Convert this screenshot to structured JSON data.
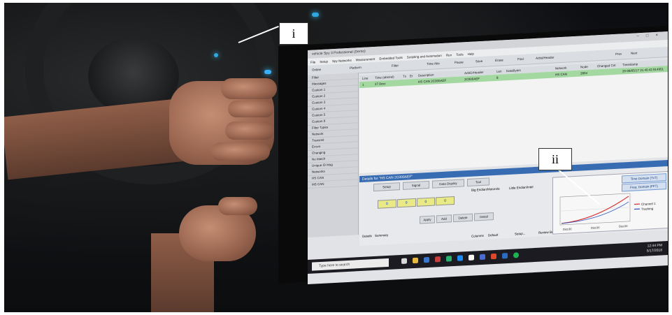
{
  "callouts": [
    {
      "id": "i",
      "label": "i"
    },
    {
      "id": "ii",
      "label": "ii"
    }
  ],
  "app": {
    "window_title": "vehicle Spy 3 Professional (Demo)",
    "menu": [
      "File",
      "Setup",
      "Spy Networks",
      "Measurement",
      "Embedded Tools",
      "Scripting and Automation",
      "Run",
      "Tools",
      "Help"
    ],
    "toolbar_items": [
      "Online",
      "Platform",
      "Filter",
      "Time Abs",
      "Pause",
      "Save",
      "Erase",
      "Find",
      "Arbid/Header",
      "Prev",
      "Next"
    ],
    "sidebar_items": [
      "Filter",
      "Messages",
      "Custom 1",
      "Custom 2",
      "Custom 3",
      "Custom 4",
      "Custom 5",
      "Custom 6",
      "Filter Types",
      "Network",
      "Transmit",
      "Errors",
      "Changing",
      "No Match",
      "Unique ID Msg",
      "Networks",
      "HS CAN",
      "MS CAN"
    ],
    "grid_headers": [
      "Line",
      "Time (abs/rel)",
      "Tx",
      "Er",
      "Description",
      "ArbID/Header",
      "Len",
      "DataBytes",
      "Network",
      "Node",
      "Changed Cnt",
      "Timestamp"
    ],
    "grid_row": [
      "1",
      "27.9xxx",
      "HS CAN 2C000AEF",
      "2C000AEF",
      "8",
      "HS CAN",
      "2804",
      "20-08/05/17 21:40:42.914951"
    ],
    "details": {
      "title": "Details for \"HS CAN 2C000AEF\"",
      "buttons": [
        "Setup",
        "Signal",
        "Data Display",
        "Tool",
        "Apply",
        "Add",
        "Delete",
        "Detail"
      ],
      "byte_values": [
        "0",
        "0",
        "0",
        "0"
      ],
      "options": [
        "Big Endian/Motorola",
        "Little Endian/Intel"
      ],
      "bottom_tabs": [
        "Details",
        "Summary"
      ],
      "columns_label": "Columns",
      "columns_value": "Default",
      "setup_label": "Setup...",
      "review_label": "Review Buffer..."
    },
    "plot": {
      "buttons": [
        "Time Domain (TxT)",
        "Freq. Domain (FFT)"
      ],
      "legend": [
        "Channel 1",
        "Tracking"
      ],
      "x_ticks": [
        "Dist.00",
        "Dist.00",
        "Dist.00"
      ]
    },
    "taskbar": {
      "search_placeholder": "Type here to search",
      "time": "12:44 PM",
      "date": "5/17/2018"
    }
  },
  "colors": {
    "callout_line": "#ffffff",
    "highlight_row": "#a9dfa6",
    "details_title": "#3a6fb8",
    "channel1": "#d33",
    "tracking": "#2a55c8"
  }
}
